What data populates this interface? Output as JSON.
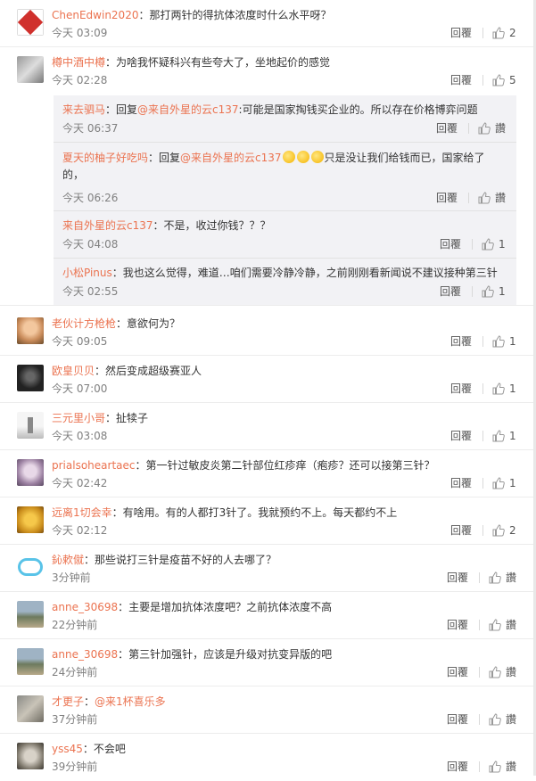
{
  "comments_top": [
    {
      "user": "ChenEdwin2020",
      "text": "：那打两针的得抗体浓度时什么水平呀？",
      "time": "今天 03:09",
      "reply": "回覆",
      "likes": "2"
    },
    {
      "user": "樽中酒中樽",
      "text": "：为啥我怀疑科兴有些夸大了，坐地起价的感觉",
      "time": "今天 02:28",
      "reply": "回覆",
      "likes": "5"
    }
  ],
  "subreplies": [
    {
      "user": "来去驷马",
      "pre": "：回复",
      "mention": "@来自外星的云c137",
      "post": ":可能是国家掏钱买企业的。所以存在价格博弈问题",
      "time": "今天 06:37",
      "reply": "回覆",
      "likes": "讚"
    },
    {
      "user": "夏天的柚子好吃吗",
      "pre": "：回复",
      "mention": "@来自外星的云c137",
      "post": "只是没让我们给钱而已，国家给了的，",
      "time": "今天 06:26",
      "reply": "回覆",
      "likes": "讚"
    },
    {
      "user": "来自外星的云c137",
      "pre": "：不是，收过你钱？？？",
      "mention": "",
      "post": "",
      "time": "今天 04:08",
      "reply": "回覆",
      "likes": "1"
    },
    {
      "user": "小松Pinus",
      "pre": "：我也这么觉得，难道…咱们需要冷静冷静，之前刚刚看新闻说不建议接种第三针",
      "mention": "",
      "post": "",
      "time": "今天 02:55",
      "reply": "回覆",
      "likes": "1"
    }
  ],
  "comments_bottom": [
    {
      "user": "老伙计方枪枪",
      "text": "：意欲何为？",
      "time": "今天 09:05",
      "reply": "回覆",
      "likes": "1"
    },
    {
      "user": "欧皇贝贝",
      "text": "：然后变成超级赛亚人",
      "time": "今天 07:00",
      "reply": "回覆",
      "likes": "1"
    },
    {
      "user": "三元里小哥",
      "text": "：扯犊子",
      "time": "今天 03:08",
      "reply": "回覆",
      "likes": "1"
    },
    {
      "user": "prialsoheartaec",
      "text": "：第一针过敏皮炎第二针部位红疹痒（疱疹？还可以接第三针？",
      "time": "今天 02:42",
      "reply": "回覆",
      "likes": "1"
    },
    {
      "user": "远离1切会幸",
      "text": "：有啥用。有的人都打3针了。我就预约不上。每天都约不上",
      "time": "今天 02:12",
      "reply": "回覆",
      "likes": "2"
    },
    {
      "user": "鈊欶僦",
      "text": "：那些说打三针是疫苗不好的人去哪了？",
      "time": "3分钟前",
      "reply": "回覆",
      "likes": "讚"
    },
    {
      "user": "anne_30698",
      "text": "：主要是增加抗体浓度吧？之前抗体浓度不高",
      "time": "22分钟前",
      "reply": "回覆",
      "likes": "讚"
    },
    {
      "user": "anne_30698",
      "text": "：第三针加强针，应该是升级对抗变异版的吧",
      "time": "24分钟前",
      "reply": "回覆",
      "likes": "讚"
    },
    {
      "user": "才更子",
      "text": "：",
      "mention": "@来1杯喜乐多",
      "time": "37分钟前",
      "reply": "回覆",
      "likes": "讚"
    },
    {
      "user": "yss45",
      "text": "：不会吧",
      "time": "39分钟前",
      "reply": "回覆",
      "likes": "讚"
    }
  ],
  "colors": {
    "username": "#eb7350",
    "text": "#333333",
    "meta": "#808080",
    "subbox": "#f2f2f5"
  }
}
